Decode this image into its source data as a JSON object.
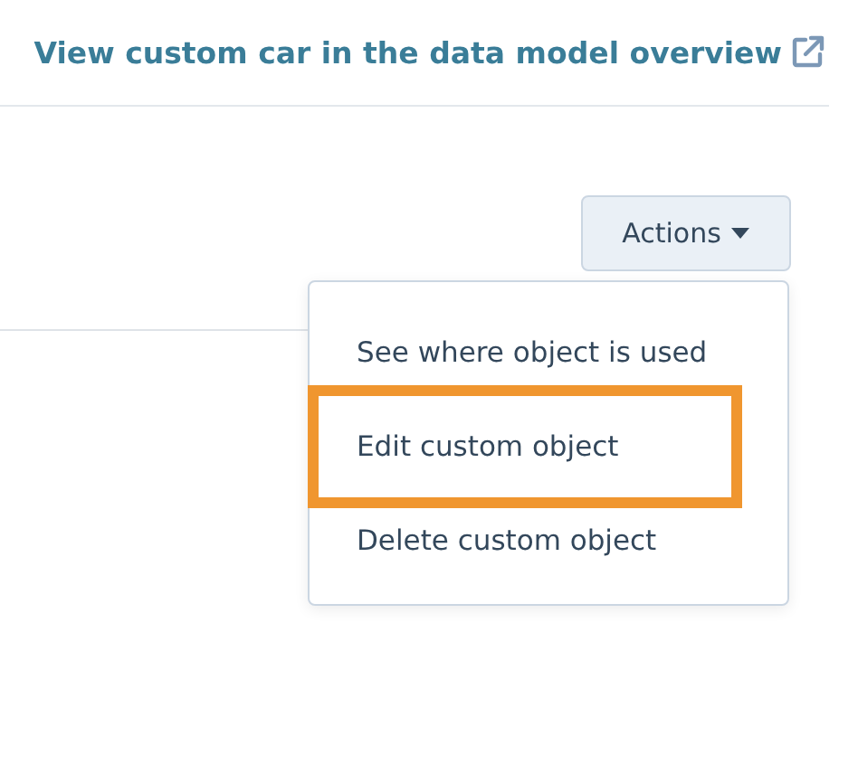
{
  "header_link": {
    "label": "View custom car in the data model overview"
  },
  "actions_button": {
    "label": "Actions"
  },
  "menu_items": [
    {
      "label": "See where object is used",
      "highlighted": false
    },
    {
      "label": "Edit custom object",
      "highlighted": true
    },
    {
      "label": "Delete custom object",
      "highlighted": false
    }
  ]
}
